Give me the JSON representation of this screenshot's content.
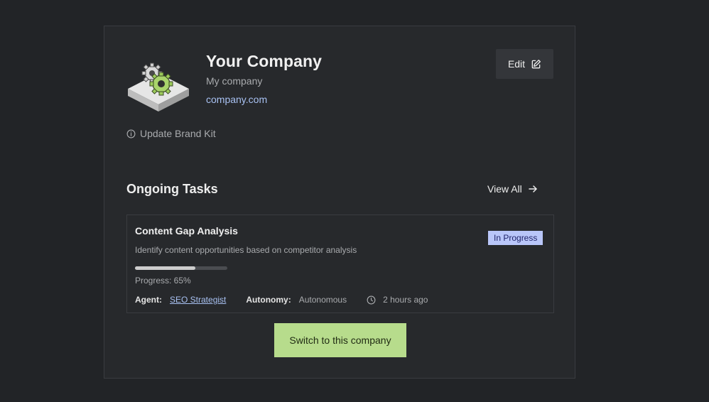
{
  "company": {
    "name": "Your Company",
    "description": "My company",
    "url": "company.com",
    "logo_icon": "gears-platform-icon"
  },
  "actions": {
    "edit_label": "Edit",
    "update_brand_kit_label": "Update Brand Kit",
    "switch_label": "Switch to this company"
  },
  "tasks_section": {
    "title": "Ongoing Tasks",
    "view_all_label": "View All"
  },
  "task": {
    "title": "Content Gap Analysis",
    "status": "In Progress",
    "description": "Identify content opportunities based on competitor analysis",
    "progress_value": 0.65,
    "progress_text": "Progress: 65%",
    "agent_label": "Agent:",
    "agent_name": "SEO Strategist",
    "autonomy_label": "Autonomy:",
    "autonomy_value": "Autonomous",
    "time": "2 hours ago"
  },
  "colors": {
    "background": "#222427",
    "card": "#27292c",
    "link": "#a8c1f2",
    "status_badge": "#b9c6f9",
    "switch_button": "#b7dc8c"
  }
}
